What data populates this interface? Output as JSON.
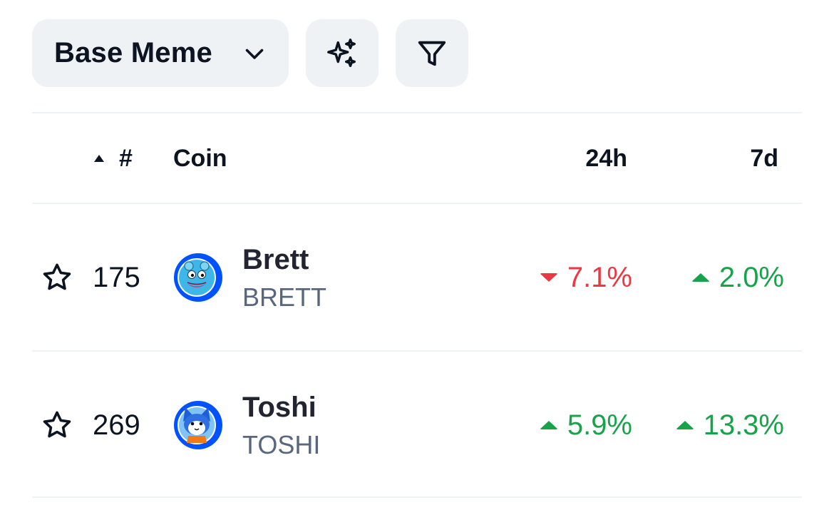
{
  "toolbar": {
    "category_label": "Base Meme",
    "category_icon": "chevron-down-icon",
    "sparkle_icon": "sparkle-icon",
    "filter_icon": "filter-icon"
  },
  "table": {
    "headers": {
      "sort_indicator": "ascending",
      "rank": "#",
      "coin": "Coin",
      "change_24h": "24h",
      "change_7d": "7d"
    },
    "rows": [
      {
        "rank": "175",
        "name": "Brett",
        "symbol": "BRETT",
        "change_24h": "7.1%",
        "change_24h_direction": "down",
        "change_7d": "2.0%",
        "change_7d_direction": "up"
      },
      {
        "rank": "269",
        "name": "Toshi",
        "symbol": "TOSHI",
        "change_24h": "5.9%",
        "change_24h_direction": "up",
        "change_7d": "13.3%",
        "change_7d_direction": "up"
      }
    ]
  },
  "colors": {
    "up": "#16a34a",
    "down": "#ea3943",
    "pill_bg": "#eff2f5",
    "logo_ring": "#0052ff"
  }
}
